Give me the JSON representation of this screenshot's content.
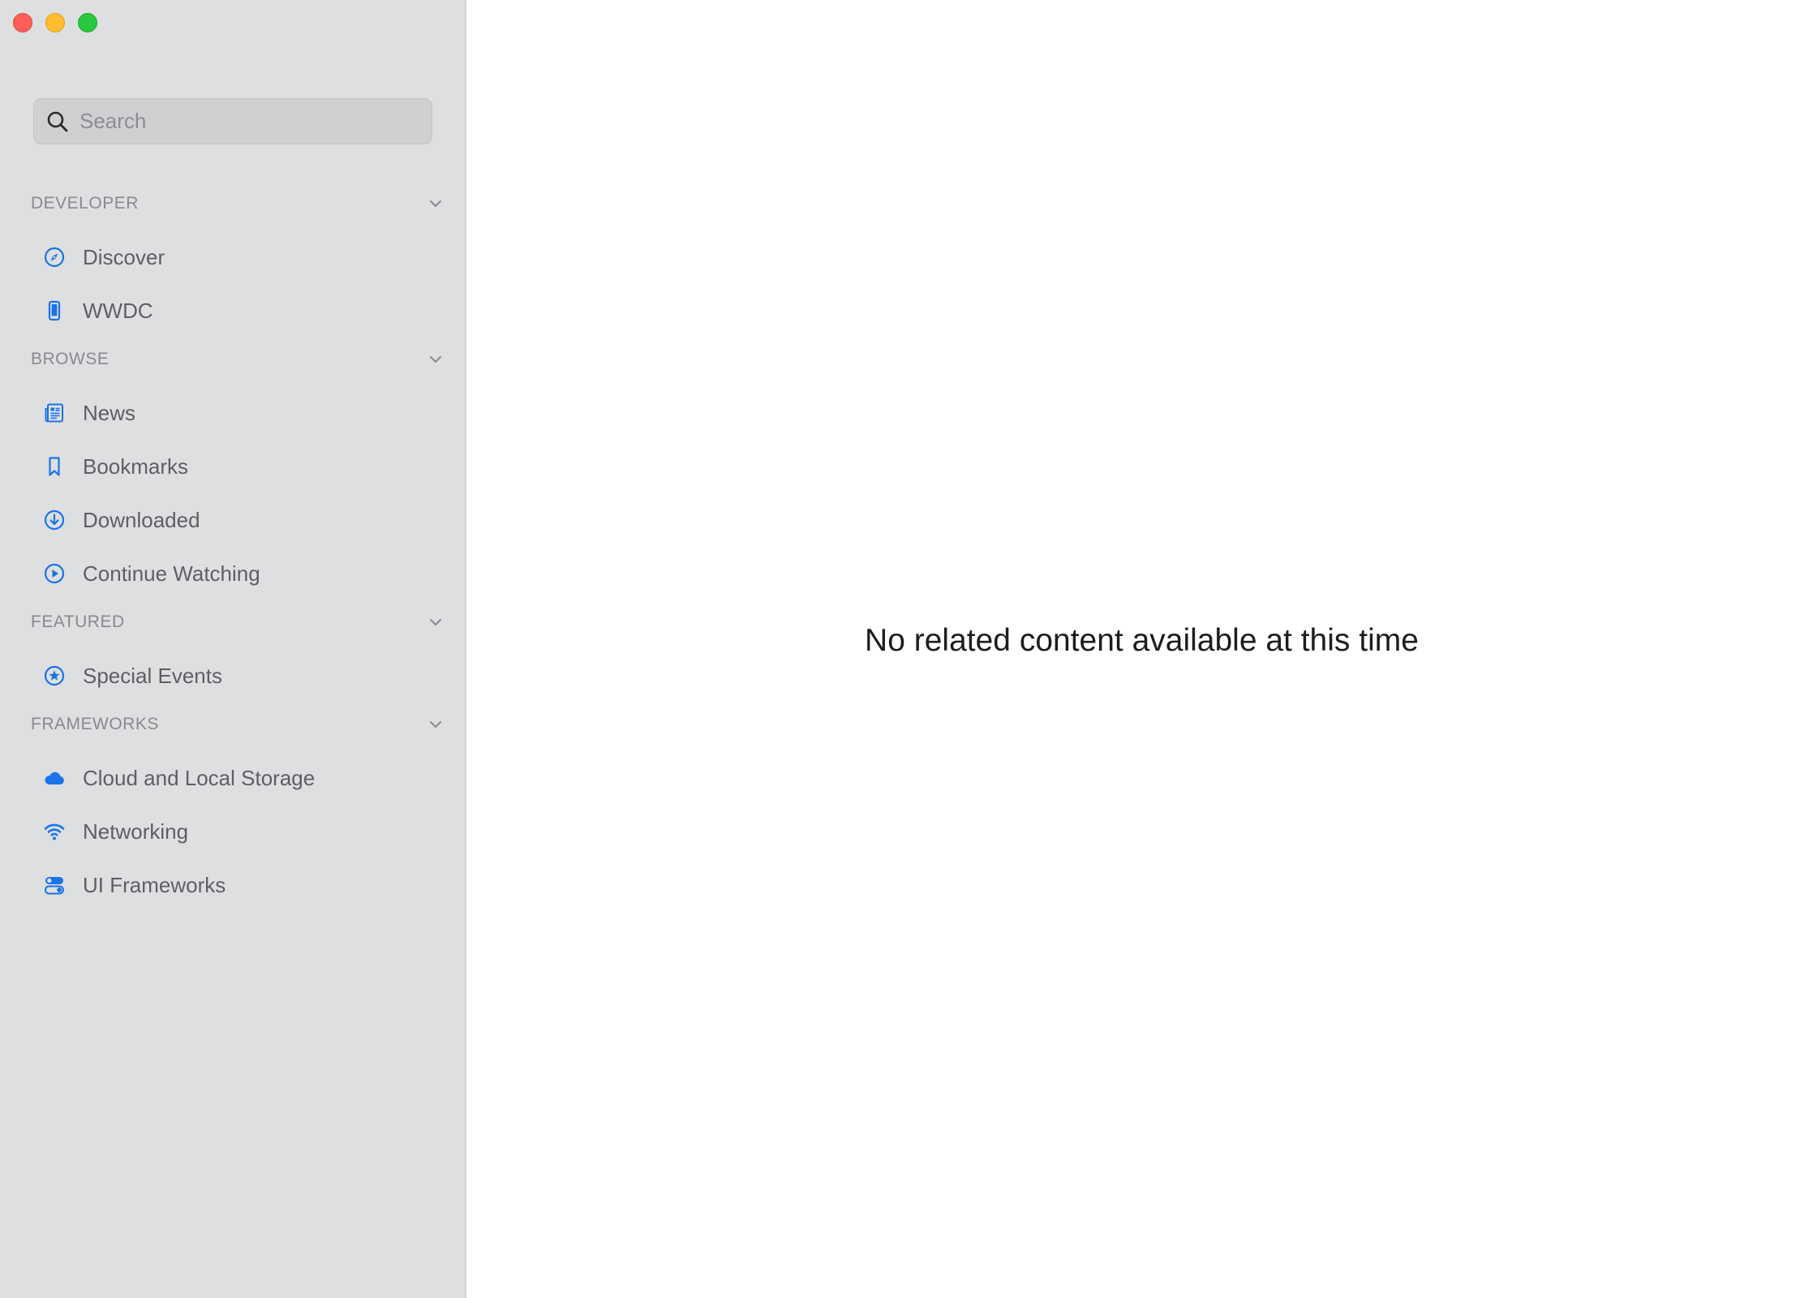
{
  "window": {
    "controls": [
      "close",
      "minimize",
      "zoom"
    ]
  },
  "sidebar": {
    "search": {
      "placeholder": "Search",
      "value": ""
    },
    "sections": {
      "developer": {
        "title": "DEVELOPER",
        "items": [
          {
            "label": "Discover",
            "icon": "compass-icon"
          },
          {
            "label": "WWDC",
            "icon": "iphone-icon"
          }
        ]
      },
      "browse": {
        "title": "BROWSE",
        "items": [
          {
            "label": "News",
            "icon": "newspaper-icon"
          },
          {
            "label": "Bookmarks",
            "icon": "bookmark-icon"
          },
          {
            "label": "Downloaded",
            "icon": "download-circle-icon"
          },
          {
            "label": "Continue Watching",
            "icon": "play-circle-icon"
          }
        ]
      },
      "featured": {
        "title": "FEATURED",
        "items": [
          {
            "label": "Special Events",
            "icon": "star-circle-icon"
          }
        ]
      },
      "frameworks": {
        "title": "FRAMEWORKS",
        "items": [
          {
            "label": "Cloud and Local Storage",
            "icon": "cloud-icon"
          },
          {
            "label": "Networking",
            "icon": "wifi-icon"
          },
          {
            "label": "UI Frameworks",
            "icon": "toggles-icon"
          }
        ]
      }
    }
  },
  "main": {
    "empty_message": "No related content available at this time"
  },
  "colors": {
    "sidebar_background": "#dedfe0",
    "accent_blue": "#1a73e8",
    "section_title": "#8a8a8e",
    "item_label": "#5f5f63",
    "main_text": "#1d1d1f"
  }
}
